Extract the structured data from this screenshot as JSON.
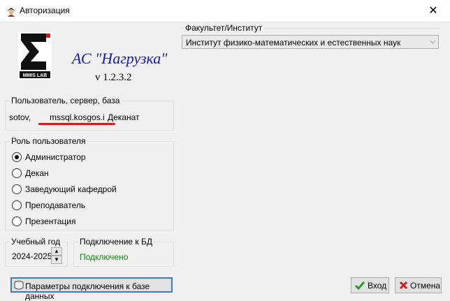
{
  "window": {
    "title": "Авторизация",
    "close_glyph": "✕"
  },
  "branding": {
    "logo_text": "MMIS LAB",
    "app_name": "АС \"Нагрузка\"",
    "version": "v 1.2.3.2"
  },
  "connection": {
    "legend": "Пользователь, сервер, база",
    "user": "sotov,",
    "server": "mssql.kosgos.i",
    "database": "Деканат"
  },
  "role": {
    "legend": "Роль пользователя",
    "options": [
      {
        "label": "Администратор",
        "checked": true
      },
      {
        "label": "Декан",
        "checked": false
      },
      {
        "label": "Заведующий кафедрой",
        "checked": false
      },
      {
        "label": "Преподаватель",
        "checked": false
      },
      {
        "label": "Презентация",
        "checked": false
      }
    ]
  },
  "year": {
    "legend": "Учебный год",
    "value": "2024-2025"
  },
  "db_status": {
    "legend": "Подключение к БД",
    "value": "Подключено",
    "color": "#0a8a0a"
  },
  "faculty": {
    "legend": "Факультет/Институт",
    "selected": "Институт физико-математических и естественных наук"
  },
  "buttons": {
    "connection_params": "Параметры подключения к базе данных",
    "enter": "Вход",
    "cancel": "Отмена"
  }
}
